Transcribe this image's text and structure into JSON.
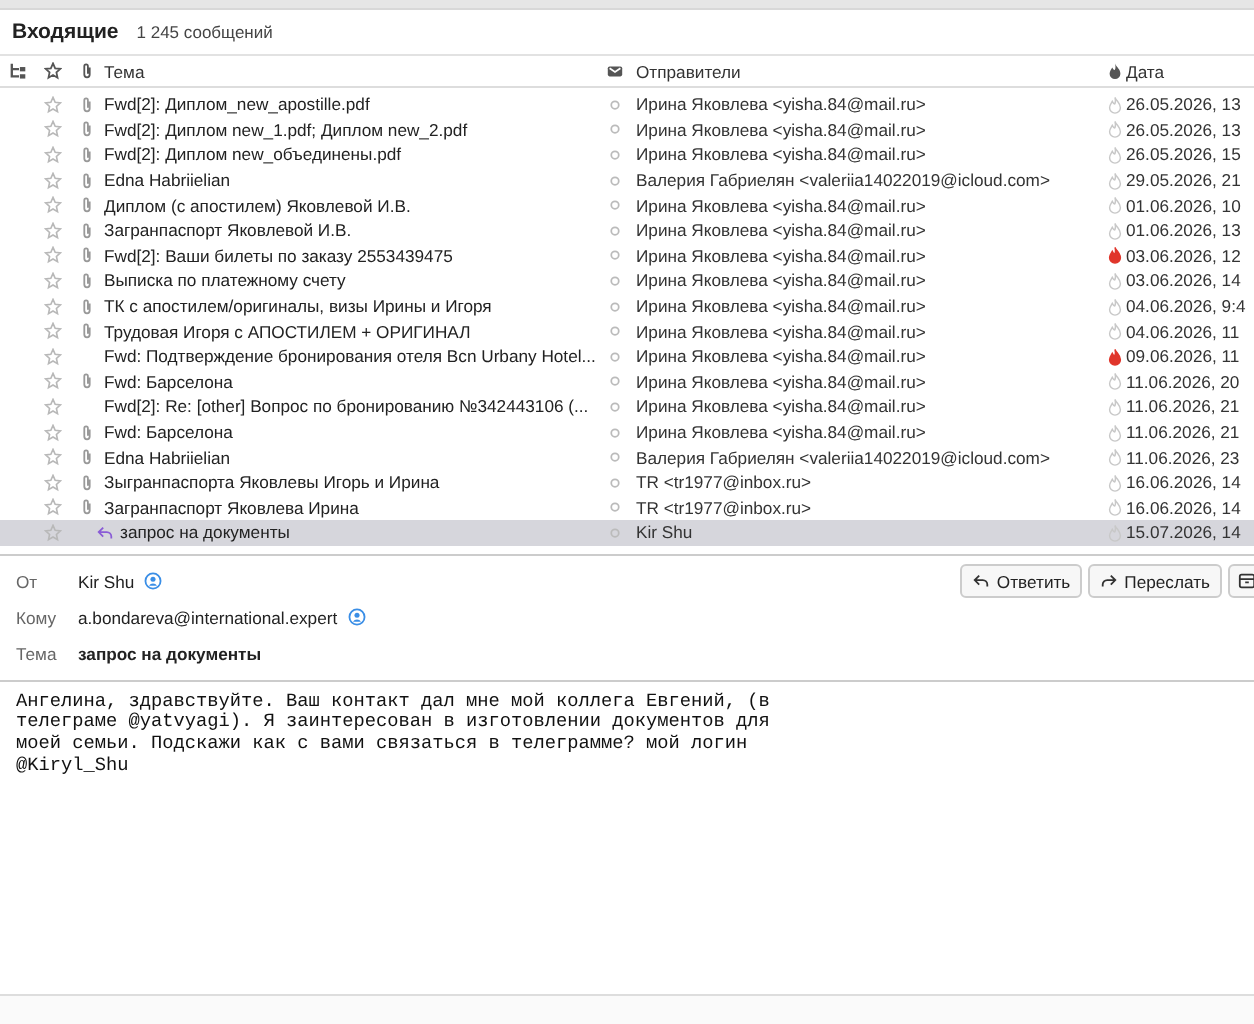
{
  "folder": {
    "title": "Входящие",
    "count": "1 245 сообщений"
  },
  "columns": {
    "subject": "Тема",
    "sender": "Отправители",
    "date": "Дата"
  },
  "rows": [
    {
      "subject": "Fwd[2]: Диплом_new_apostille.pdf",
      "sender": "Ирина Яковлева <yisha.84@mail.ru>",
      "date": "26.05.2026, 13",
      "attachment": true,
      "hot": false,
      "replied": false,
      "selected": false
    },
    {
      "subject": "Fwd[2]: Диплом new_1.pdf; Диплом new_2.pdf",
      "sender": "Ирина Яковлева <yisha.84@mail.ru>",
      "date": "26.05.2026, 13",
      "attachment": true,
      "hot": false,
      "replied": false,
      "selected": false
    },
    {
      "subject": "Fwd[2]: Диплом new_объединены.pdf",
      "sender": "Ирина Яковлева <yisha.84@mail.ru>",
      "date": "26.05.2026, 15",
      "attachment": true,
      "hot": false,
      "replied": false,
      "selected": false
    },
    {
      "subject": "Edna Habriielian",
      "sender": "Валерия Габриелян <valeriia14022019@icloud.com>",
      "date": "29.05.2026, 21",
      "attachment": true,
      "hot": false,
      "replied": false,
      "selected": false
    },
    {
      "subject": "Диплом (с апостилем) Яковлевой И.В.",
      "sender": "Ирина Яковлева <yisha.84@mail.ru>",
      "date": "01.06.2026, 10",
      "attachment": true,
      "hot": false,
      "replied": false,
      "selected": false
    },
    {
      "subject": "Загранпаспорт Яковлевой И.В.",
      "sender": "Ирина Яковлева <yisha.84@mail.ru>",
      "date": "01.06.2026, 13",
      "attachment": true,
      "hot": false,
      "replied": false,
      "selected": false
    },
    {
      "subject": "Fwd[2]: Ваши билеты по заказу 2553439475",
      "sender": "Ирина Яковлева <yisha.84@mail.ru>",
      "date": "03.06.2026, 12",
      "attachment": true,
      "hot": true,
      "replied": false,
      "selected": false
    },
    {
      "subject": "Выписка по платежному счету",
      "sender": "Ирина Яковлева <yisha.84@mail.ru>",
      "date": "03.06.2026, 14",
      "attachment": true,
      "hot": false,
      "replied": false,
      "selected": false
    },
    {
      "subject": "ТК с апостилем/оригиналы, визы Ирины и Игоря",
      "sender": "Ирина Яковлева <yisha.84@mail.ru>",
      "date": "04.06.2026, 9:4",
      "attachment": true,
      "hot": false,
      "replied": false,
      "selected": false
    },
    {
      "subject": "Трудовая Игоря с АПОСТИЛЕМ + ОРИГИНАЛ",
      "sender": "Ирина Яковлева <yisha.84@mail.ru>",
      "date": "04.06.2026, 11",
      "attachment": true,
      "hot": false,
      "replied": false,
      "selected": false
    },
    {
      "subject": "Fwd: Подтверждение бронирования отеля Bcn Urbany Hotel...",
      "sender": "Ирина Яковлева <yisha.84@mail.ru>",
      "date": "09.06.2026, 11",
      "attachment": false,
      "hot": true,
      "replied": false,
      "selected": false
    },
    {
      "subject": "Fwd: Барселона",
      "sender": "Ирина Яковлева <yisha.84@mail.ru>",
      "date": "11.06.2026, 20",
      "attachment": true,
      "hot": false,
      "replied": false,
      "selected": false
    },
    {
      "subject": "Fwd[2]: Re: [other] Вопрос по бронированию №342443106 (...",
      "sender": "Ирина Яковлева <yisha.84@mail.ru>",
      "date": "11.06.2026, 21",
      "attachment": false,
      "hot": false,
      "replied": false,
      "selected": false
    },
    {
      "subject": "Fwd: Барселона",
      "sender": "Ирина Яковлева <yisha.84@mail.ru>",
      "date": "11.06.2026, 21",
      "attachment": true,
      "hot": false,
      "replied": false,
      "selected": false
    },
    {
      "subject": "Edna Habriielian",
      "sender": "Валерия Габриелян <valeriia14022019@icloud.com>",
      "date": "11.06.2026, 23",
      "attachment": true,
      "hot": false,
      "replied": false,
      "selected": false
    },
    {
      "subject": "Зыгранпаспорта Яковлевы Игорь и Ирина",
      "sender": "TR <tr1977@inbox.ru>",
      "date": "16.06.2026, 14",
      "attachment": true,
      "hot": false,
      "replied": false,
      "selected": false
    },
    {
      "subject": "Загранпаспорт Яковлева Ирина",
      "sender": "TR <tr1977@inbox.ru>",
      "date": "16.06.2026, 14",
      "attachment": true,
      "hot": false,
      "replied": false,
      "selected": false
    },
    {
      "subject": "запрос на документы",
      "sender": "Kir Shu",
      "date": "15.07.2026, 14",
      "attachment": false,
      "hot": false,
      "replied": true,
      "selected": true
    }
  ],
  "message": {
    "from_label": "От",
    "from": "Kir Shu",
    "to_label": "Кому",
    "to": "a.bondareva@international.expert",
    "subject_label": "Тема",
    "subject": "запрос на документы",
    "buttons": [
      {
        "kind": "reply",
        "label": "Ответить"
      },
      {
        "kind": "forward",
        "label": "Переслать"
      },
      {
        "kind": "archive"
      }
    ],
    "body": "Ангелина, здравствуйте. Ваш контакт дал мне мой коллега Евгений, (в\nтелеграме @yatvyagi). Я заинтересован в изготовлении документов для\nмоей семьи. Подскажи как с вами связаться в телеграмме? мой логин\n@Kiryl_Shu"
  }
}
